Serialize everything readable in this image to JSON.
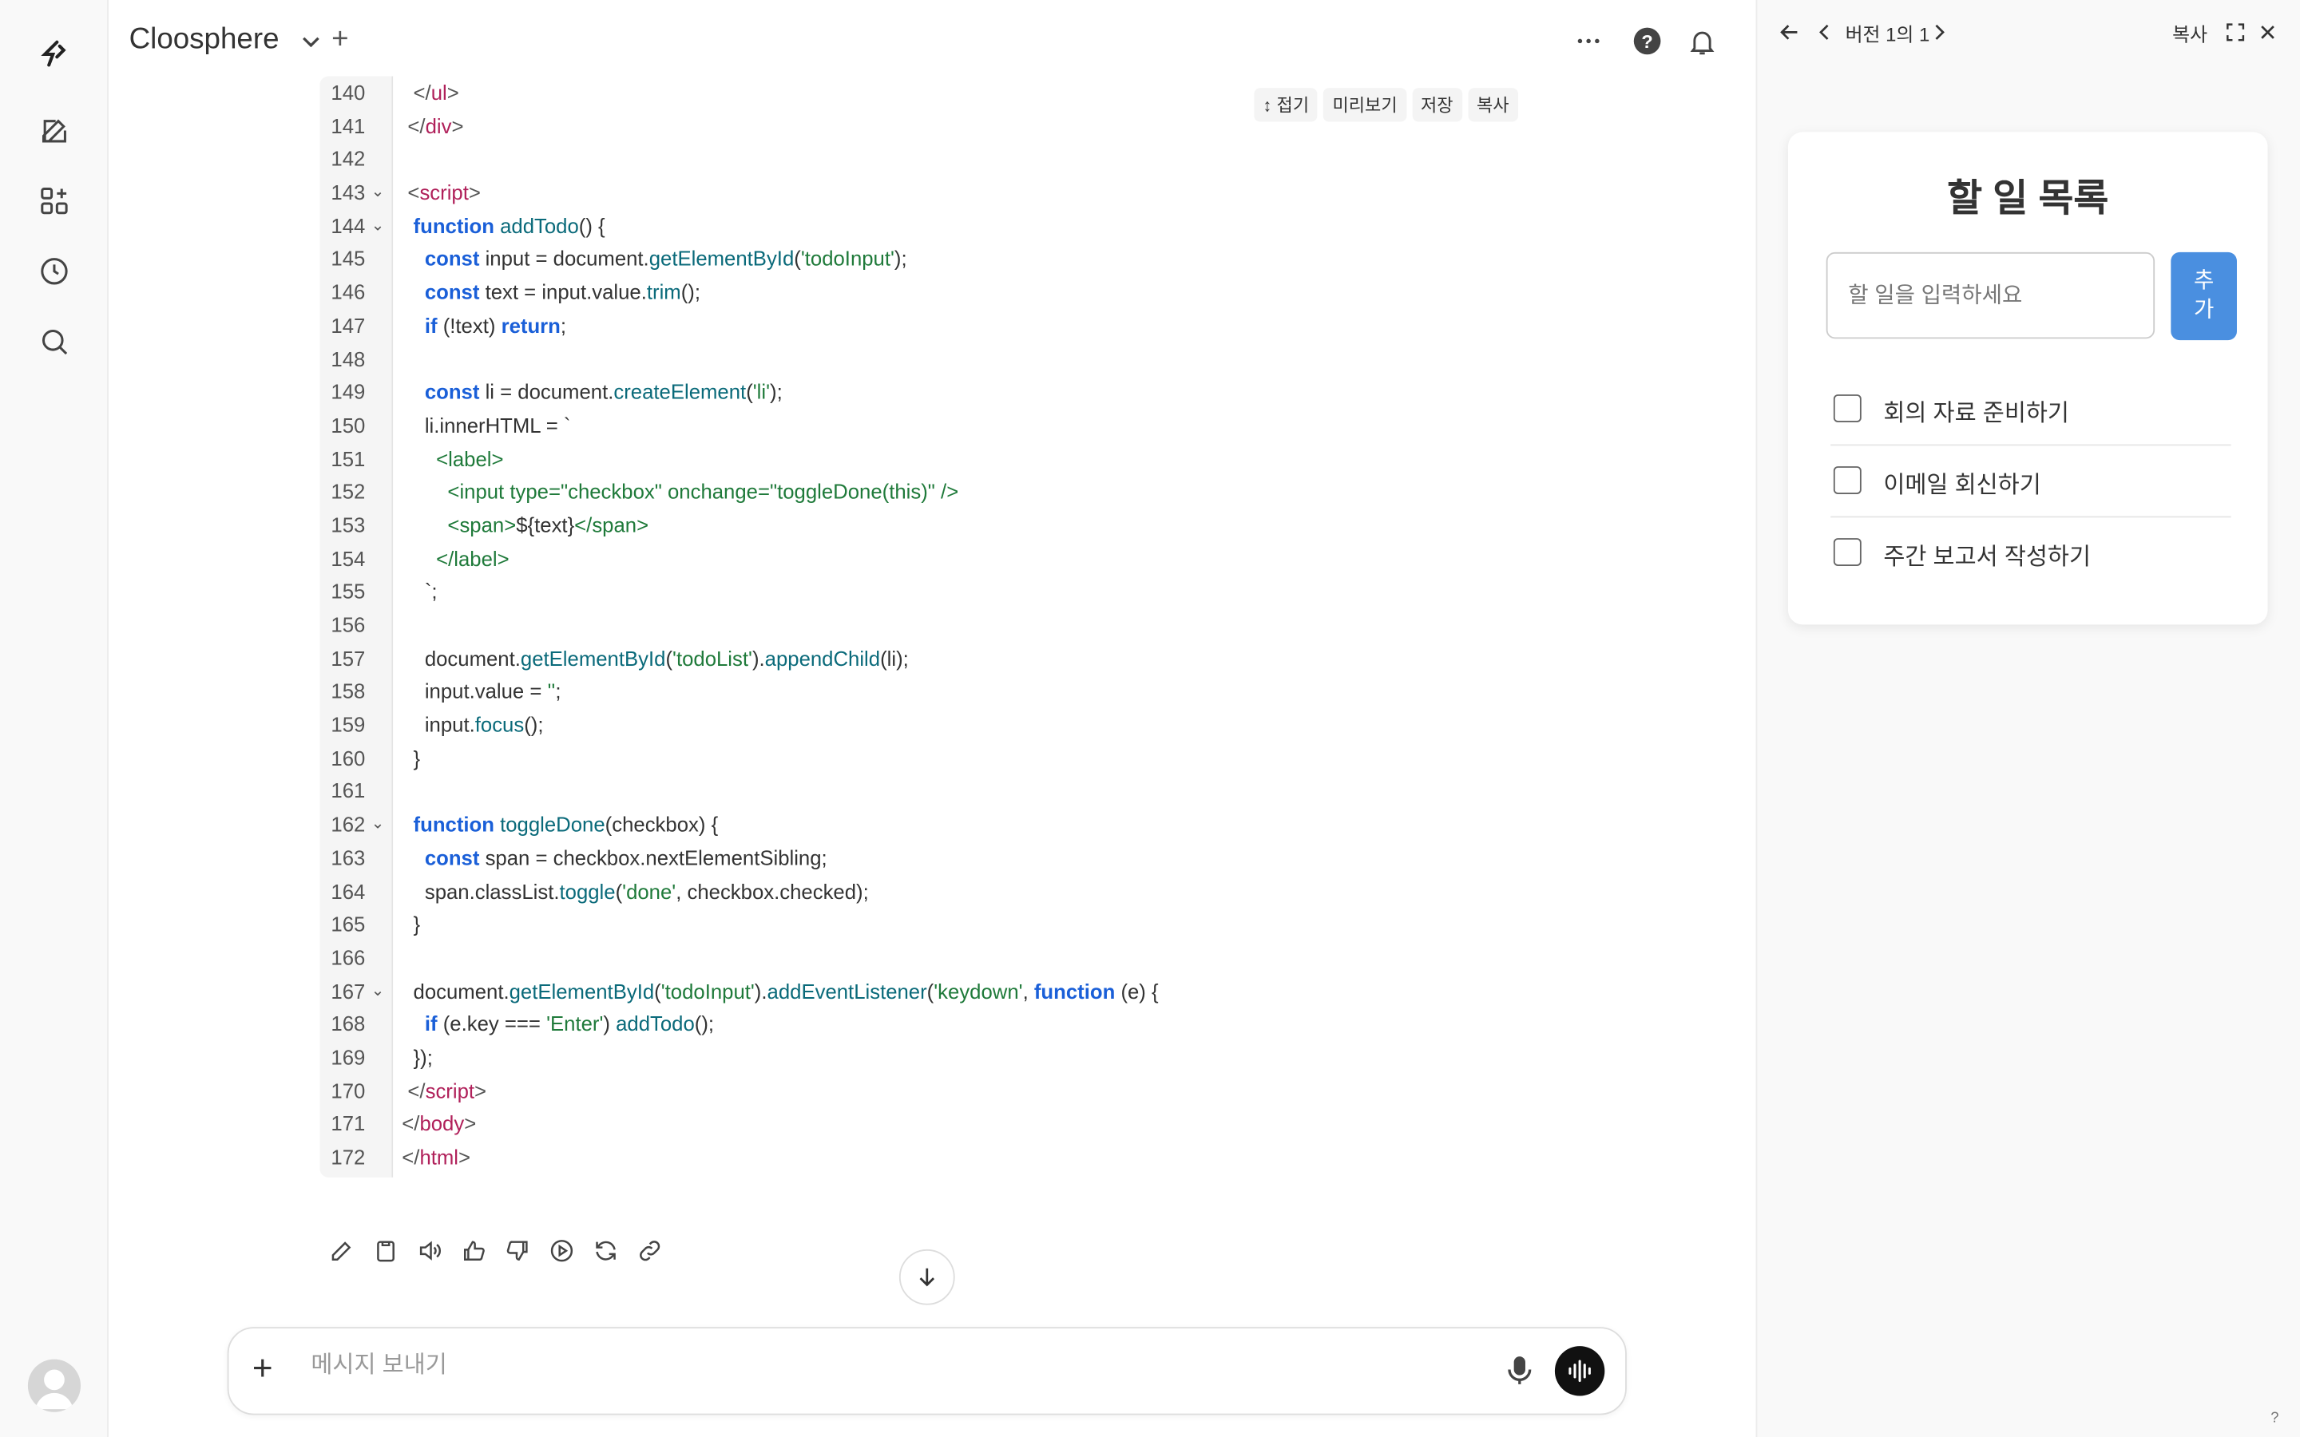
{
  "header": {
    "app_title": "Cloosphere"
  },
  "code_toolbar": {
    "fold": "↕ 접기",
    "preview": "미리보기",
    "save": "저장",
    "copy": "복사"
  },
  "code": {
    "lines": [
      {
        "n": "140",
        "fold": false,
        "html": "<span class='punc'>  &lt;/</span><span class='tag'>ul</span><span class='punc'>&gt;</span>"
      },
      {
        "n": "141",
        "fold": false,
        "html": "<span class='punc'> &lt;/</span><span class='tag'>div</span><span class='punc'>&gt;</span>"
      },
      {
        "n": "142",
        "fold": false,
        "html": ""
      },
      {
        "n": "143",
        "fold": true,
        "html": "<span class='punc'> &lt;</span><span class='tag'>script</span><span class='punc'>&gt;</span>"
      },
      {
        "n": "144",
        "fold": true,
        "html": "  <span class='kw'>function</span> <span class='fn'>addTodo</span>() {"
      },
      {
        "n": "145",
        "fold": false,
        "html": "    <span class='kw'>const</span> input = document.<span class='fn'>getElementById</span>(<span class='str'>'todoInput'</span>);"
      },
      {
        "n": "146",
        "fold": false,
        "html": "    <span class='kw'>const</span> text = input.value.<span class='fn'>trim</span>();"
      },
      {
        "n": "147",
        "fold": false,
        "html": "    <span class='kw'>if</span> (!text) <span class='kw'>return</span>;"
      },
      {
        "n": "148",
        "fold": false,
        "html": ""
      },
      {
        "n": "149",
        "fold": false,
        "html": "    <span class='kw'>const</span> li = document.<span class='fn'>createElement</span>(<span class='str'>'li'</span>);"
      },
      {
        "n": "150",
        "fold": false,
        "html": "    li.innerHTML = `"
      },
      {
        "n": "151",
        "fold": false,
        "html": "      <span class='str'>&lt;label&gt;</span>"
      },
      {
        "n": "152",
        "fold": false,
        "html": "        <span class='str'>&lt;input type=\"checkbox\" onchange=\"toggleDone(this)\" /&gt;</span>"
      },
      {
        "n": "153",
        "fold": false,
        "html": "        <span class='str'>&lt;span&gt;</span>${text}<span class='str'>&lt;/span&gt;</span>"
      },
      {
        "n": "154",
        "fold": false,
        "html": "      <span class='str'>&lt;/label&gt;</span>"
      },
      {
        "n": "155",
        "fold": false,
        "html": "    `;"
      },
      {
        "n": "156",
        "fold": false,
        "html": ""
      },
      {
        "n": "157",
        "fold": false,
        "html": "    document.<span class='fn'>getElementById</span>(<span class='str'>'todoList'</span>).<span class='fn'>appendChild</span>(li);"
      },
      {
        "n": "158",
        "fold": false,
        "html": "    input.value = <span class='str'>''</span>;"
      },
      {
        "n": "159",
        "fold": false,
        "html": "    input.<span class='fn'>focus</span>();"
      },
      {
        "n": "160",
        "fold": false,
        "html": "  }"
      },
      {
        "n": "161",
        "fold": false,
        "html": ""
      },
      {
        "n": "162",
        "fold": true,
        "html": "  <span class='kw'>function</span> <span class='fn'>toggleDone</span>(checkbox) {"
      },
      {
        "n": "163",
        "fold": false,
        "html": "    <span class='kw'>const</span> span = checkbox.nextElementSibling;"
      },
      {
        "n": "164",
        "fold": false,
        "html": "    span.classList.<span class='fn'>toggle</span>(<span class='str'>'done'</span>, checkbox.checked);"
      },
      {
        "n": "165",
        "fold": false,
        "html": "  }"
      },
      {
        "n": "166",
        "fold": false,
        "html": ""
      },
      {
        "n": "167",
        "fold": true,
        "html": "  document.<span class='fn'>getElementById</span>(<span class='str'>'todoInput'</span>).<span class='fn'>addEventListener</span>(<span class='str'>'keydown'</span>, <span class='kw'>function</span> (e) {"
      },
      {
        "n": "168",
        "fold": false,
        "html": "    <span class='kw'>if</span> (e.key === <span class='str'>'Enter'</span>) <span class='fn'>addTodo</span>();"
      },
      {
        "n": "169",
        "fold": false,
        "html": "  });"
      },
      {
        "n": "170",
        "fold": false,
        "html": "<span class='punc'> &lt;/</span><span class='tag'>script</span><span class='punc'>&gt;</span>"
      },
      {
        "n": "171",
        "fold": false,
        "html": "<span class='punc'>&lt;/</span><span class='tag'>body</span><span class='punc'>&gt;</span>"
      },
      {
        "n": "172",
        "fold": false,
        "html": "<span class='punc'>&lt;/</span><span class='tag'>html</span><span class='punc'>&gt;</span>"
      }
    ]
  },
  "composer": {
    "placeholder": "메시지 보내기"
  },
  "panel": {
    "version": "버전 1의 1",
    "copy": "복사",
    "card_title": "할 일 목록",
    "input_placeholder": "할 일을 입력하세요",
    "add_button": "추가",
    "todos": [
      "회의 자료 준비하기",
      "이메일 회신하기",
      "주간 보고서 작성하기"
    ]
  },
  "help": "?"
}
